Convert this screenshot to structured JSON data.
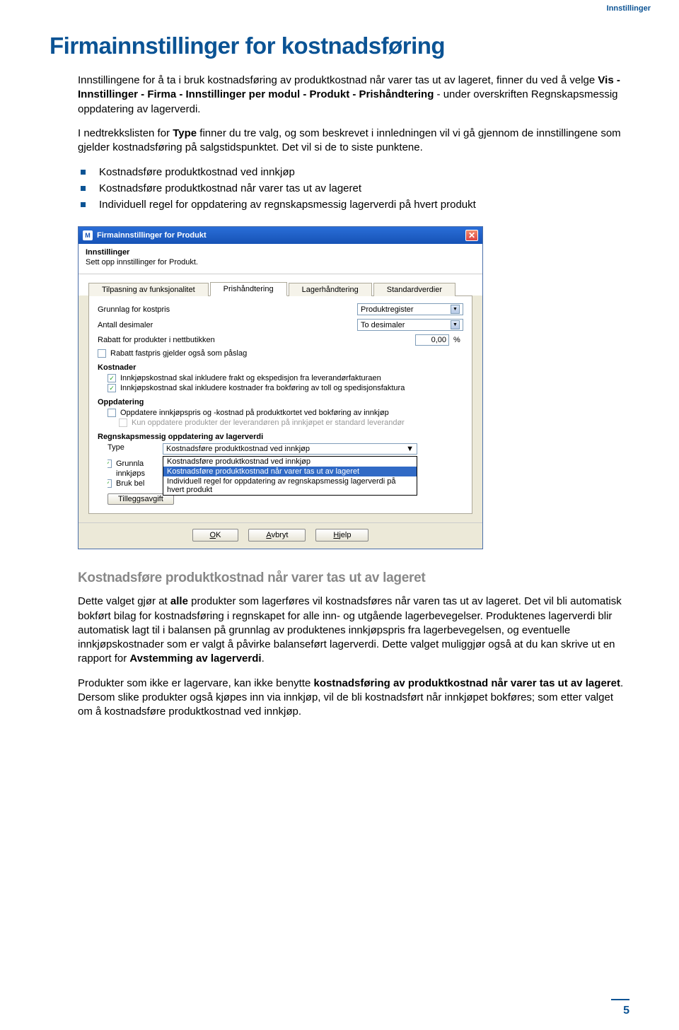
{
  "header_right": "Innstillinger",
  "main_heading": "Firmainnstillinger for kostnadsføring",
  "para1_a": "Innstillingene for å ta i bruk kostnadsføring av produktkostnad når varer tas ut av lageret, finner du ved å velge ",
  "para1_b": "Vis - Innstillinger - Firma - Innstillinger per modul - Produkt - Prishåndtering",
  "para1_c": " - under overskriften Regnskapsmessig oppdatering av lagerverdi.",
  "para2_a": "I nedtrekkslisten for ",
  "para2_b": "Type",
  "para2_c": " finner du tre valg, og som beskrevet i innledningen vil vi gå gjennom de innstillingene som gjelder kostnadsføring på salgstidspunktet. Det vil si de to siste punktene.",
  "bullets": [
    "Kostnadsføre produktkostnad ved innkjøp",
    "Kostnadsføre produktkostnad når varer tas ut av lageret",
    "Individuell regel for oppdatering av regnskapsmessig lagerverdi på hvert produkt"
  ],
  "dialog": {
    "title": "Firmainnstillinger for Produkt",
    "top_hdr": "Innstillinger",
    "top_sub": "Sett opp innstillinger for Produkt.",
    "tabs": [
      "Tilpasning av funksjonalitet",
      "Prishåndtering",
      "Lagerhåndtering",
      "Standardverdier"
    ],
    "active_tab": 1,
    "row_kostpris_label": "Grunnlag for kostpris",
    "row_kostpris_value": "Produktregister",
    "row_desimaler_label": "Antall desimaler",
    "row_desimaler_value": "To desimaler",
    "row_rabatt_label": "Rabatt for produkter i nettbutikken",
    "row_rabatt_value": "0,00",
    "row_rabatt_unit": "%",
    "chk_rabatt_fastpris": "Rabatt fastpris gjelder også som påslag",
    "section_kostnader": "Kostnader",
    "chk_frakt": "Innkjøpskostnad skal inkludere frakt og ekspedisjon fra leverandørfakturaen",
    "chk_toll": "Innkjøpskostnad skal inkludere kostnader fra bokføring av toll og spedisjonsfaktura",
    "section_oppdatering": "Oppdatering",
    "chk_oppdatere": "Oppdatere innkjøpspris og -kostnad på produktkortet ved bokføring av innkjøp",
    "chk_kun": "Kun oppdatere produkter der leverandøren på innkjøpet er standard leverandør",
    "section_regnskap": "Regnskapsmessig oppdatering av lagerverdi",
    "type_label": "Type",
    "type_value": "Kostnadsføre produktkostnad ved innkjøp",
    "dropdown_opts": [
      "Kostnadsføre produktkostnad ved innkjøp",
      "Kostnadsføre produktkostnad når varer tas ut av lageret",
      "Individuell regel for oppdatering av regnskapsmessig lagerverdi på hvert produkt"
    ],
    "dropdown_selected": 1,
    "side_chk_1a": "Grunnla",
    "side_chk_1b": "innkjøps",
    "side_chk_2": "Bruk bel",
    "btn_tillegg": "Tilleggsavgift",
    "btn_ok": "OK",
    "btn_avbryt": "Avbryt",
    "btn_hjelp": "Hjelp"
  },
  "sub_heading": "Kostnadsføre produktkostnad når varer tas ut av lageret",
  "para3_a": "Dette valget gjør at ",
  "para3_b": "alle",
  "para3_c": " produkter som lagerføres vil kostnadsføres når varen tas ut av lageret. Det vil bli automatisk bokført bilag for kostnadsføring i regnskapet for alle inn- og utgående lagerbevegelser. Produktenes lagerverdi blir automatisk lagt til i balansen på grunnlag av produktenes innkjøpspris fra lagerbevegelsen, og eventuelle innkjøpskostnader som er valgt å påvirke balanseført lagerverdi. Dette valget muliggjør også at du kan skrive ut en rapport for ",
  "para3_d": "Avstemming av lagerverdi",
  "para3_e": ".",
  "para4_a": "Produkter som ikke er lagervare, kan ikke benytte ",
  "para4_b": "kostnadsføring av produktkostnad når varer tas ut av lageret",
  "para4_c": ". Dersom slike produkter også kjøpes inn via innkjøp, vil de bli kostnadsført når innkjøpet bokføres; som etter valget om å kostnadsføre produktkostnad ved innkjøp.",
  "page_num": "5"
}
